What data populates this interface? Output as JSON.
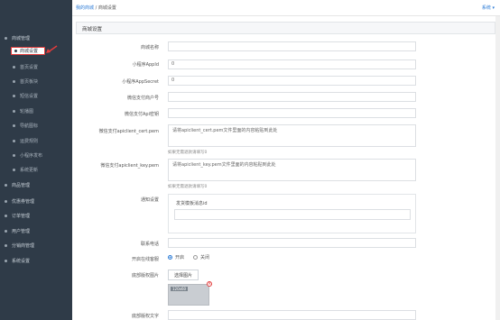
{
  "breadcrumb": {
    "home": "我的商城",
    "sep": "/",
    "current": "商城设置"
  },
  "topbar": {
    "system_menu": "系统 ▾"
  },
  "sidebar": {
    "items": [
      {
        "label": "商城管理",
        "level": "top"
      },
      {
        "label": "商城设置",
        "level": "active"
      },
      {
        "label": "首页设置",
        "level": "sub"
      },
      {
        "label": "首页板块",
        "level": "sub"
      },
      {
        "label": "短信设置",
        "level": "sub"
      },
      {
        "label": "轮播图",
        "level": "sub"
      },
      {
        "label": "导航图标",
        "level": "sub"
      },
      {
        "label": "运费规则",
        "level": "sub"
      },
      {
        "label": "小程序发布",
        "level": "sub"
      },
      {
        "label": "系统更新",
        "level": "sub"
      },
      {
        "label": "商品管理",
        "level": "top"
      },
      {
        "label": "优惠券管理",
        "level": "top"
      },
      {
        "label": "订单管理",
        "level": "top"
      },
      {
        "label": "用户管理",
        "level": "top"
      },
      {
        "label": "分销商管理",
        "level": "top"
      },
      {
        "label": "系统设置",
        "level": "top"
      }
    ]
  },
  "panel": {
    "title": "商城设置"
  },
  "form": {
    "store_name": {
      "label": "商城名称",
      "value": ""
    },
    "appid": {
      "label": "小程序AppId",
      "value": "0"
    },
    "appsecret": {
      "label": "小程序AppSecret",
      "value": "0"
    },
    "mch_id": {
      "label": "微信支付商户号",
      "value": ""
    },
    "api_key": {
      "label": "微信支付Api密钥",
      "value": ""
    },
    "cert_pem": {
      "label": "微信支付apiclient_cert.pem",
      "placeholder": "请将apiclient_cert.pem文件里面的内容粘贴到此处",
      "hint": "如果无需退款请填写0"
    },
    "key_pem": {
      "label": "微信支付apiclient_key.pem",
      "placeholder": "请将apiclient_key.pem文件里面的内容粘贴到此处",
      "hint": "如果无需退款请填写0"
    },
    "notify": {
      "label": "通知设置",
      "template_label": "发货模板消息id",
      "value": ""
    },
    "phone": {
      "label": "联系电话",
      "value": ""
    },
    "online_service": {
      "label": "开启在线客服",
      "on": "开启",
      "off": "关闭",
      "selected": "开启"
    },
    "copyright_image": {
      "label": "底部版权图片",
      "button": "选择图片",
      "thumb_label": "120x60",
      "remove": "×"
    },
    "copyright_text": {
      "label": "底部版权文字",
      "value": ""
    }
  }
}
